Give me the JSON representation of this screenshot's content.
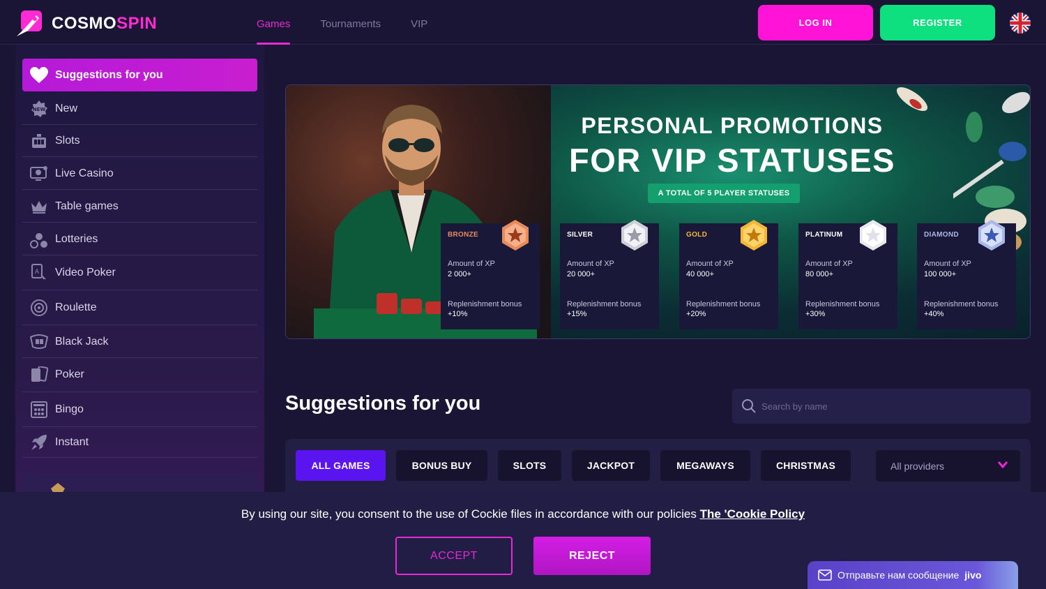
{
  "header": {
    "logo": {
      "part1": "COSMO",
      "part2": "SPIN"
    },
    "nav": [
      {
        "label": "Games",
        "active": true
      },
      {
        "label": "Tournaments",
        "active": false
      },
      {
        "label": "VIP",
        "active": false
      }
    ],
    "login_label": "LOG IN",
    "register_label": "REGISTER",
    "language_flag": "uk-flag-icon"
  },
  "sidebar": {
    "active": {
      "label": "Suggestions for you",
      "icon": "heart-icon"
    },
    "items": [
      {
        "label": "New",
        "icon": "new-badge-icon"
      },
      {
        "label": "Slots",
        "icon": "slot-machine-icon"
      },
      {
        "label": "Live Casino",
        "icon": "live-monitor-icon"
      },
      {
        "label": "Table games",
        "icon": "crown-icon"
      },
      {
        "label": "Lotteries",
        "icon": "lottery-balls-icon"
      },
      {
        "label": "Video Poker",
        "icon": "card-cursor-icon"
      },
      {
        "label": "Roulette",
        "icon": "roulette-icon"
      },
      {
        "label": "Black Jack",
        "icon": "blackjack-icon"
      },
      {
        "label": "Poker",
        "icon": "cards-icon"
      },
      {
        "label": "Bingo",
        "icon": "bingo-icon"
      },
      {
        "label": "Instant",
        "icon": "rocket-icon"
      }
    ]
  },
  "banner": {
    "title_line1": "PERSONAL PROMOTIONS",
    "title_line2": "FOR VIP STATUSES",
    "badge": "A TOTAL OF 5 PLAYER STATUSES",
    "statuses": [
      {
        "name": "BRONZE",
        "xp_label": "Amount of XP",
        "xp": "2 000+",
        "bonus_label": "Replenishment bonus",
        "bonus": "+10%",
        "color": "#e98a5a"
      },
      {
        "name": "SILVER",
        "xp_label": "Amount of XP",
        "xp": "20 000+",
        "bonus_label": "Replenishment bonus",
        "bonus": "+15%",
        "color": "#ffffff"
      },
      {
        "name": "GOLD",
        "xp_label": "Amount of XP",
        "xp": "40 000+",
        "bonus_label": "Replenishment bonus",
        "bonus": "+20%",
        "color": "#f5b536"
      },
      {
        "name": "PLATINUM",
        "xp_label": "Amount of XP",
        "xp": "80 000+",
        "bonus_label": "Replenishment bonus",
        "bonus": "+30%",
        "color": "#ffffff"
      },
      {
        "name": "DIAMOND",
        "xp_label": "Amount of XP",
        "xp": "100 000+",
        "bonus_label": "Replenishment bonus",
        "bonus": "+40%",
        "color": "#aab8e8"
      }
    ]
  },
  "suggestions": {
    "title": "Suggestions for you",
    "search_placeholder": "Search by name",
    "filters": [
      {
        "label": "ALL GAMES",
        "active": true
      },
      {
        "label": "BONUS BUY",
        "active": false
      },
      {
        "label": "SLOTS",
        "active": false
      },
      {
        "label": "JACKPOT",
        "active": false
      },
      {
        "label": "MEGAWAYS",
        "active": false
      },
      {
        "label": "CHRISTMAS",
        "active": false
      }
    ],
    "providers_selected": "All providers"
  },
  "cookie": {
    "text": "By using our site, you consent to the use of Cockie files in accordance with our policies",
    "link": "The 'Cookie Policy",
    "accept_label": "ACCEPT",
    "reject_label": "REJECT"
  },
  "chat": {
    "text": "Отправьте нам сообщение",
    "brand": "jivo"
  },
  "colors": {
    "accent_pink": "#e62ad6",
    "register_green": "#0ee07f",
    "active_chip": "#5a14f0",
    "background": "#1a1535"
  }
}
